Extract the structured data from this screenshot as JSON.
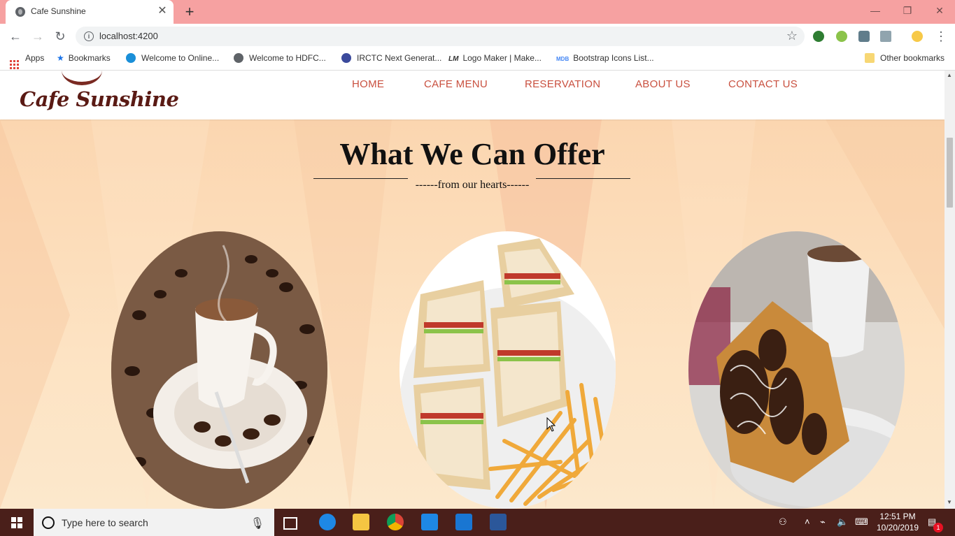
{
  "browser": {
    "tab_title": "Cafe Sunshine",
    "tab_close": "✕",
    "new_tab": "+",
    "url": "localhost:4200",
    "window_controls": {
      "minimize": "—",
      "restore": "❐",
      "close": "✕"
    },
    "bookmarks": [
      {
        "label": "Apps",
        "icon": "apps-grid-icon"
      },
      {
        "label": "Bookmarks",
        "icon": "star-icon"
      },
      {
        "label": "Welcome to Online...",
        "icon": "globe-blue-icon"
      },
      {
        "label": "Welcome to HDFC...",
        "icon": "globe-icon"
      },
      {
        "label": "IRCTC Next Generat...",
        "icon": "irctc-icon"
      },
      {
        "label": "Logo Maker | Make...",
        "icon": "lm-icon"
      },
      {
        "label": "Bootstrap Icons List...",
        "icon": "mdb-icon"
      }
    ],
    "other_bookmarks": "Other bookmarks"
  },
  "site": {
    "logo_text": "Cafe Sunshine",
    "nav": [
      "HOME",
      "CAFE MENU",
      "RESERVATION",
      "ABOUT US",
      "CONTACT US"
    ],
    "hero_title": "What We Can Offer",
    "hero_subtitle": "------from our hearts------",
    "offer_images": [
      "coffee-cup-with-beans",
      "club-sandwich-with-fries",
      "chocolate-waffles-with-coffee"
    ]
  },
  "taskbar": {
    "search_placeholder": "Type here to search",
    "time": "12:51 PM",
    "date": "10/20/2019",
    "notification_count": "1"
  },
  "colors": {
    "titlebar": "#f6a1a1",
    "nav_link": "#c9503f",
    "logo": "#5a1a14",
    "hero_bg": "#fbd6b0",
    "taskbar": "#4a1f1a"
  }
}
